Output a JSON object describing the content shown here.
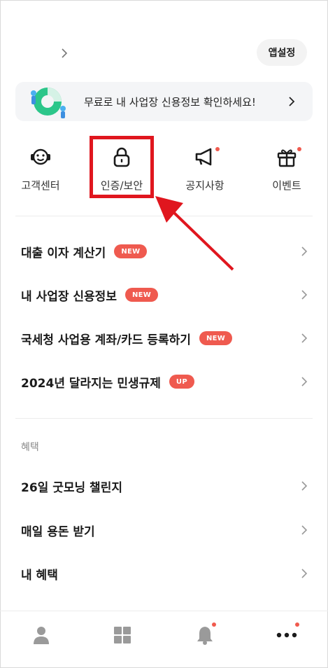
{
  "header": {
    "app_settings_label": "앱설정",
    "profile_chevron_icon": "chevron-right-icon"
  },
  "banner": {
    "text": "무료로 내 사업장 신용정보 확인하세요!",
    "chevron_icon": "chevron-right-icon"
  },
  "quick_menu": [
    {
      "label": "고객센터",
      "icon": "headset-icon",
      "has_dot": false
    },
    {
      "label": "인증/보안",
      "icon": "lock-icon",
      "has_dot": false
    },
    {
      "label": "공지사항",
      "icon": "megaphone-icon",
      "has_dot": true
    },
    {
      "label": "이벤트",
      "icon": "gift-icon",
      "has_dot": true
    }
  ],
  "menu": [
    {
      "label": "대출 이자 계산기",
      "badge": "NEW"
    },
    {
      "label": "내 사업장 신용정보",
      "badge": "NEW"
    },
    {
      "label": "국세청 사업용 계좌/카드 등록하기",
      "badge": "NEW"
    },
    {
      "label": "2024년 달라지는 민생규제",
      "badge": "UP"
    }
  ],
  "benefits": {
    "section_title": "혜택",
    "items": [
      {
        "label": "26일 굿모닝 챌린지"
      },
      {
        "label": "매일 용돈 받기"
      },
      {
        "label": "내 혜택"
      }
    ]
  },
  "bottom_nav": [
    {
      "icon": "person-icon",
      "has_dot": false
    },
    {
      "icon": "grid-icon",
      "has_dot": false
    },
    {
      "icon": "bell-icon",
      "has_dot": true
    },
    {
      "icon": "more-icon",
      "has_dot": true
    }
  ],
  "colors": {
    "accent_red": "#ef5a4f",
    "annotation_red": "#e0161e",
    "icon_gray": "#9a9a9a"
  }
}
